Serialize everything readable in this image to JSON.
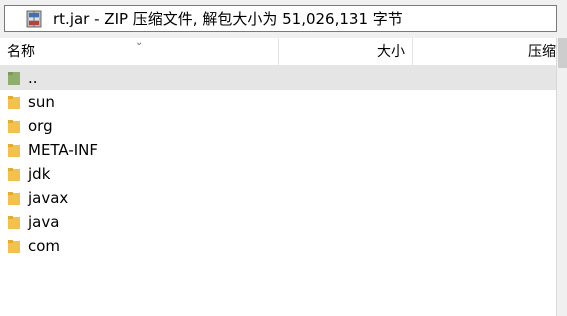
{
  "pathbar": {
    "path": "rt.jar - ZIP 压缩文件, 解包大小为 51,026,131 字节",
    "icon": "archive-icon"
  },
  "columns": {
    "name": "名称",
    "size": "大小",
    "compressed": "压缩"
  },
  "rows": [
    {
      "label": "..",
      "selected": true
    },
    {
      "label": "sun"
    },
    {
      "label": "org"
    },
    {
      "label": "META-INF"
    },
    {
      "label": "jdk"
    },
    {
      "label": "javax"
    },
    {
      "label": "java"
    },
    {
      "label": "com"
    }
  ],
  "colors": {
    "folder": "#f2c14e",
    "selected_row": "#e5e5e5",
    "grid_line": "#e5e5e5"
  }
}
